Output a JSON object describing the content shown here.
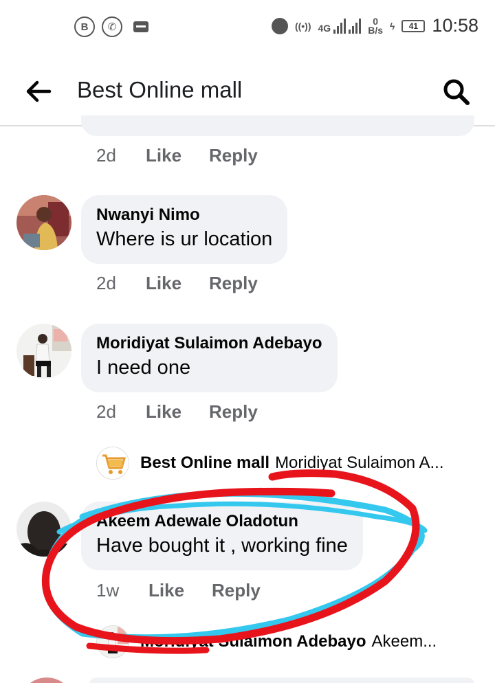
{
  "status_bar": {
    "left_icons": [
      "b-icon",
      "whatsapp-icon",
      "message-icon"
    ],
    "network": "4G",
    "speed_value": "0",
    "speed_unit": "B/s",
    "battery": "41",
    "time": "10:58"
  },
  "header": {
    "title": "Best Online mall"
  },
  "comments": [
    {
      "time": "2d",
      "like_label": "Like",
      "reply_label": "Reply"
    },
    {
      "author": "Nwanyi Nimo",
      "text": "Where is ur location",
      "time": "2d",
      "like_label": "Like",
      "reply_label": "Reply"
    },
    {
      "author": "Moridiyat Sulaimon Adebayo",
      "text": "I need one",
      "time": "2d",
      "like_label": "Like",
      "reply_label": "Reply",
      "reply_preview": {
        "author": "Best Online mall",
        "text": "Moridiyat Sulaimon A..."
      }
    },
    {
      "author": "Akeem Adewale Oladotun",
      "text": "Have bought it , working fine",
      "time": "1w",
      "like_label": "Like",
      "reply_label": "Reply",
      "reply_preview": {
        "author": "Moridiyat Sulaimon Adebayo",
        "text": "Akeem..."
      }
    }
  ],
  "colors": {
    "bubble": "#f0f2f5",
    "meta_text": "#65676b",
    "annotation_red": "#e8141c",
    "annotation_blue": "#35c8ee"
  }
}
